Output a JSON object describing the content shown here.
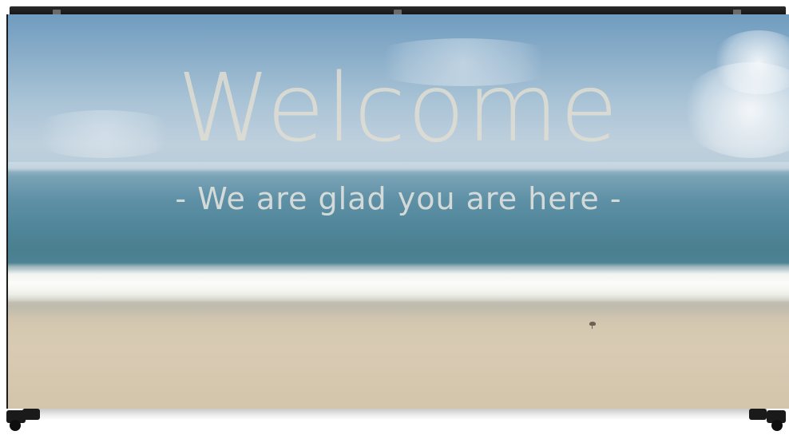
{
  "banner": {
    "title": "Welcome",
    "subtitle": "- We are glad you are here -"
  },
  "scene": {
    "background": "beach-ocean-photo",
    "elements": [
      "sky-with-clouds",
      "ocean",
      "surf-wave",
      "sand-beach",
      "shorebird"
    ]
  },
  "stand": {
    "frame_color": "#1c1c1c",
    "parts": [
      "top-rail",
      "bottom-bar",
      "caster-wheels"
    ]
  },
  "colors": {
    "text": "#e2ded2",
    "sky": "#89adc9",
    "ocean": "#4f8598",
    "sand": "#d8cbb3"
  }
}
